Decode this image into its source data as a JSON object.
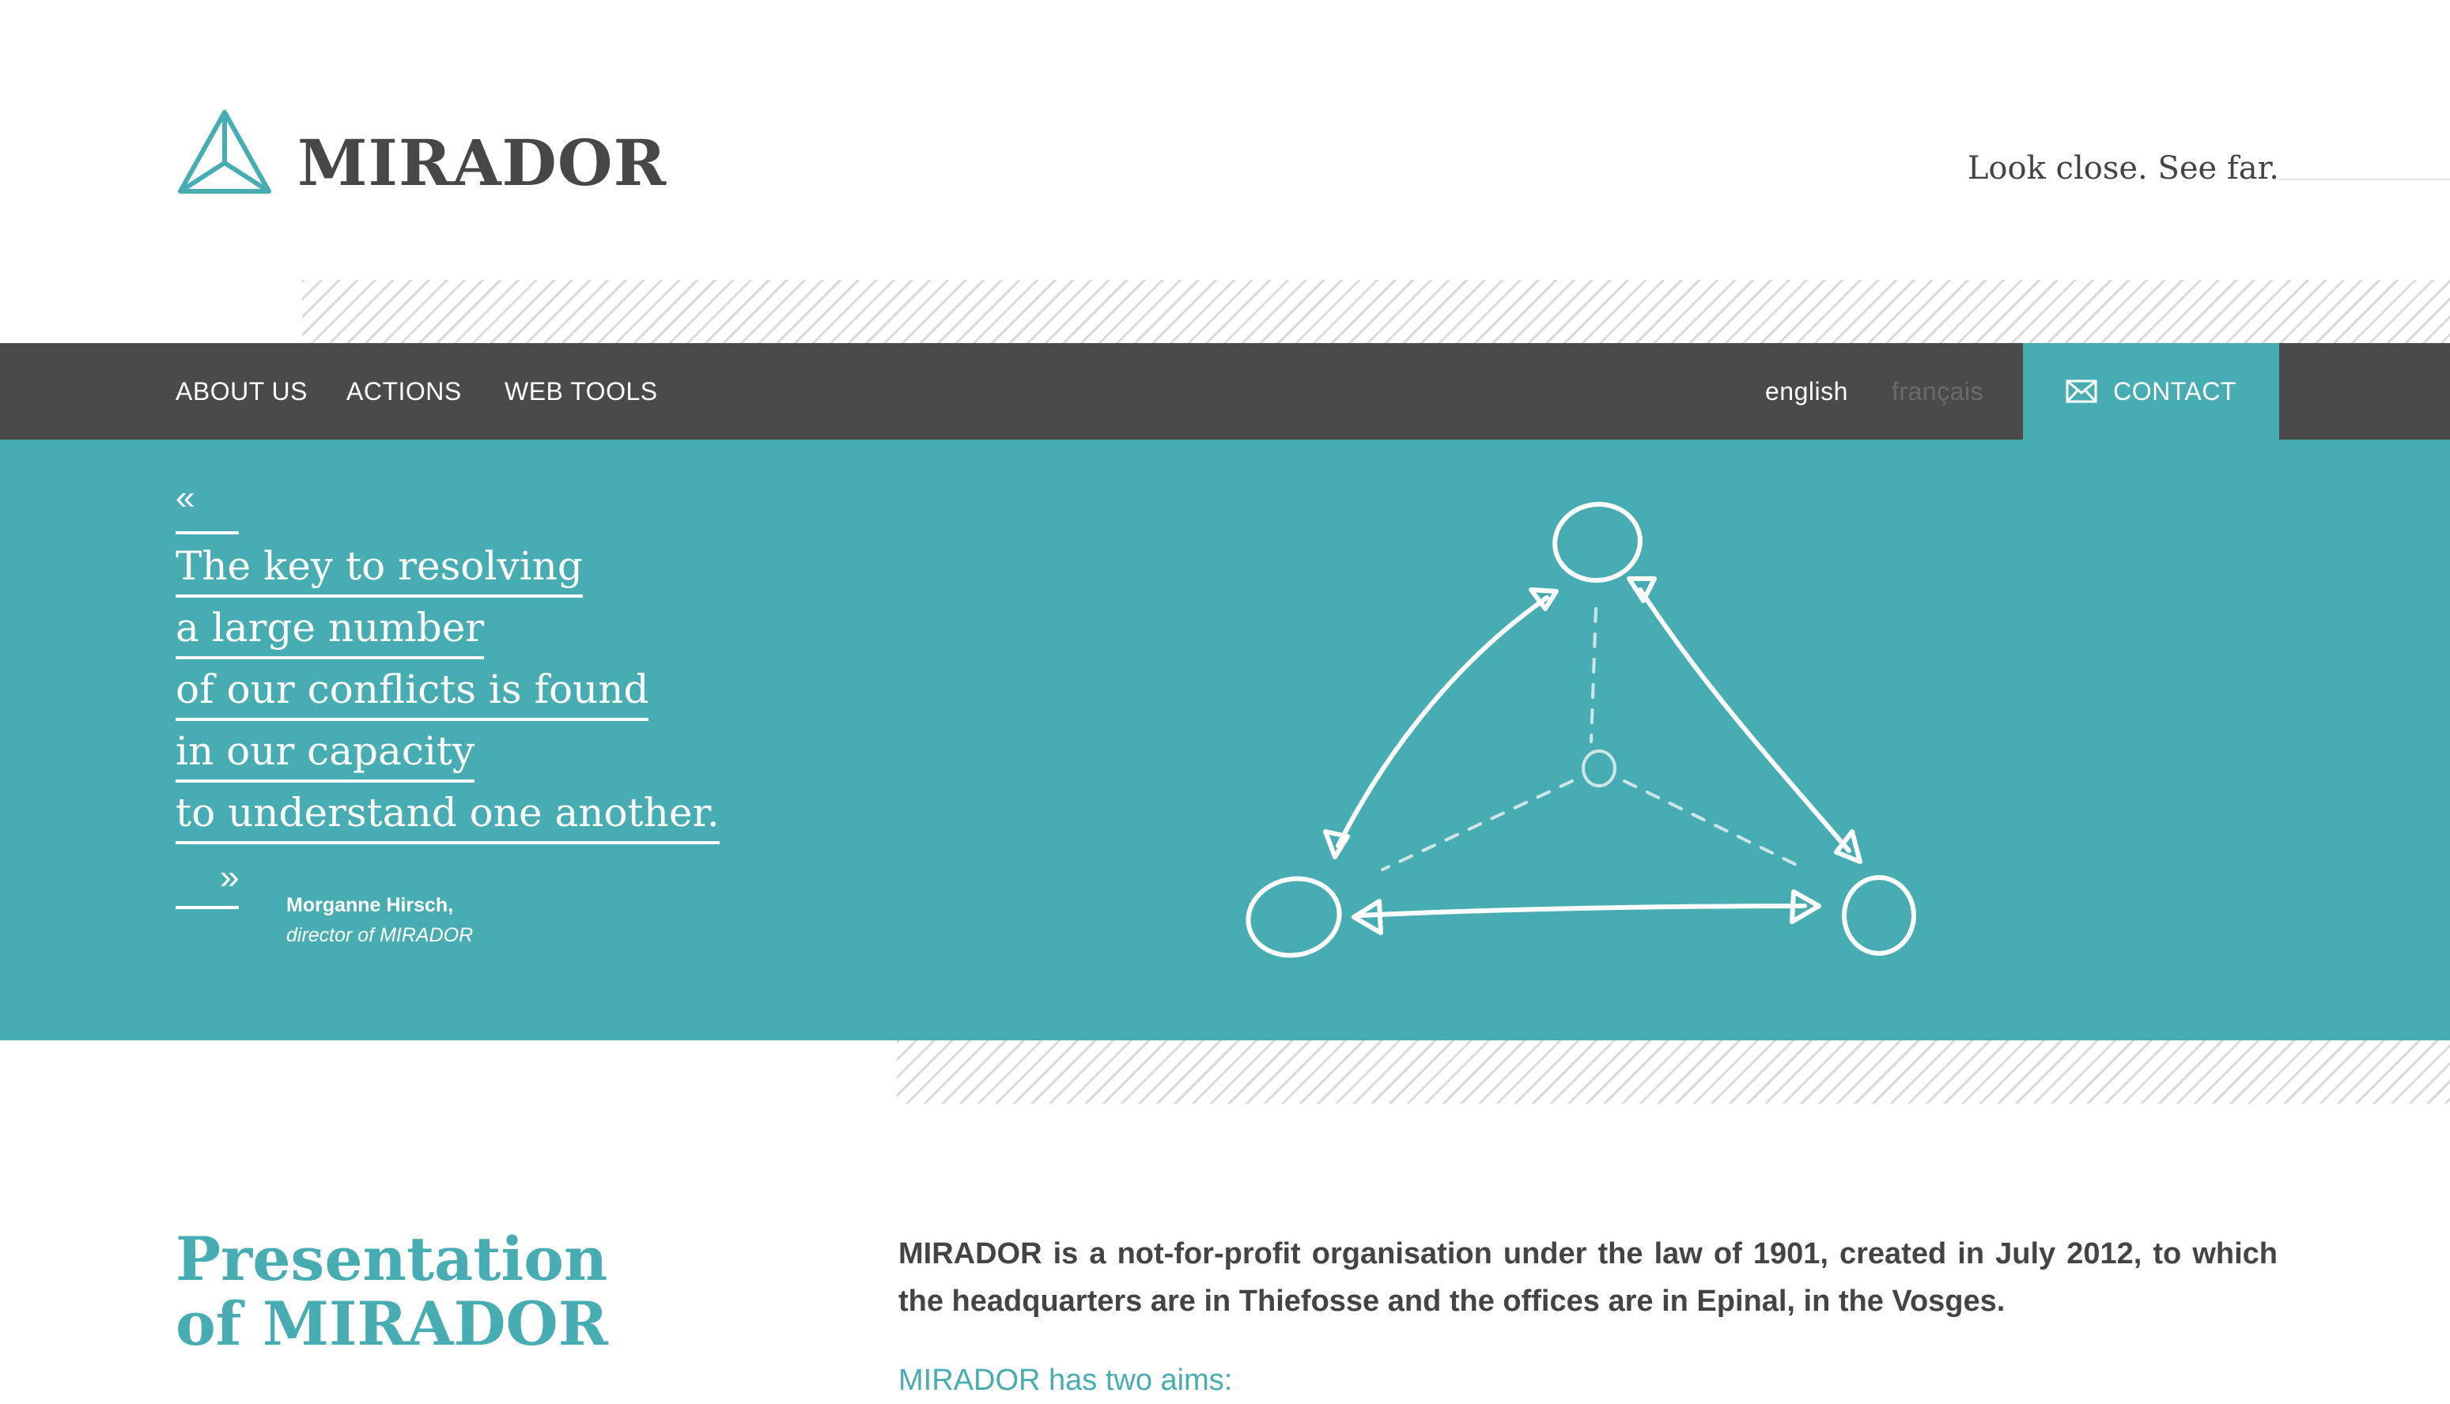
{
  "brand": {
    "name": "MIRADOR",
    "tagline": "Look close. See far."
  },
  "nav": {
    "items": [
      {
        "label": "ABOUT US"
      },
      {
        "label": "ACTIONS"
      },
      {
        "label": "WEB TOOLS"
      }
    ],
    "languages": [
      {
        "label": "english",
        "active": true
      },
      {
        "label": "français",
        "active": false
      }
    ],
    "contact": {
      "label": "CONTACT",
      "icon": "envelope-icon"
    }
  },
  "hero": {
    "quote_open": "«",
    "quote_close": "»",
    "quote_lines": [
      "The key to resolving",
      "a large number",
      "of our conflicts is found",
      "in our capacity",
      "to understand one another."
    ],
    "author_name": "Morganne Hirsch,",
    "author_role": "director of MIRADOR"
  },
  "presentation": {
    "title_line1": "Presentation",
    "title_line2": "of MIRADOR",
    "body": "MIRADOR is a not-for-profit organisation under the law of 1901, created in July 2012, to which the headquarters are in Thiefosse and the offices are in Epinal, in the Vosges.",
    "aims": "MIRADOR has two aims:"
  },
  "colors": {
    "accent": "#48adb3",
    "nav_bg": "#4a4a4a",
    "text": "#444444",
    "inactive_lang": "#6b6b6b"
  }
}
